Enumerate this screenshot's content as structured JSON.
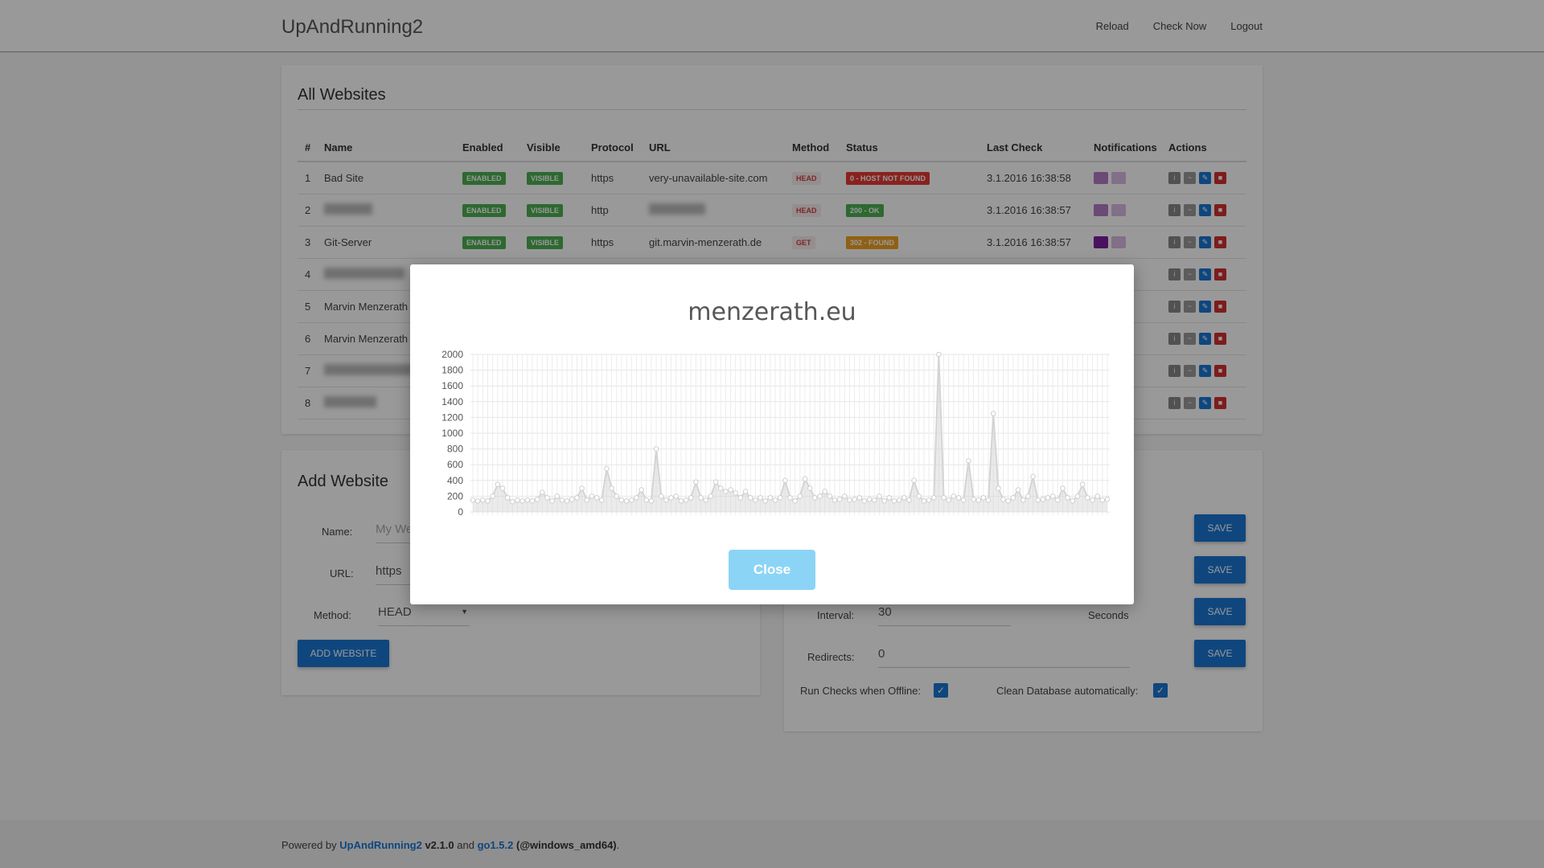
{
  "navbar": {
    "brand": "UpAndRunning2",
    "links": [
      "Reload",
      "Check Now",
      "Logout"
    ]
  },
  "all_websites": {
    "title": "All Websites",
    "columns": [
      "#",
      "Name",
      "Enabled",
      "Visible",
      "Protocol",
      "URL",
      "Method",
      "Status",
      "Last Check",
      "Notifications",
      "Actions"
    ],
    "rows": [
      {
        "num": "1",
        "name": "Bad Site",
        "enabled": "ENABLED",
        "visible": "VISIBLE",
        "protocol": "https",
        "url": "very-unavailable-site.com",
        "method": "HEAD",
        "status": "0 - HOST NOT FOUND",
        "last_check": "3.1.2016 16:38:58"
      },
      {
        "num": "2",
        "name": "",
        "enabled": "ENABLED",
        "visible": "VISIBLE",
        "protocol": "http",
        "url": "",
        "method": "HEAD",
        "status": "200 - OK",
        "last_check": "3.1.2016 16:38:57"
      },
      {
        "num": "3",
        "name": "Git-Server",
        "enabled": "ENABLED",
        "visible": "VISIBLE",
        "protocol": "https",
        "url": "git.marvin-menzerath.de",
        "method": "GET",
        "status": "302 - FOUND",
        "last_check": "3.1.2016 16:38:57"
      },
      {
        "num": "4",
        "name": ""
      },
      {
        "num": "5",
        "name": "Marvin Menzerath"
      },
      {
        "num": "6",
        "name": "Marvin Menzerath"
      },
      {
        "num": "7",
        "name": ""
      },
      {
        "num": "8",
        "name": ""
      }
    ]
  },
  "add_website": {
    "title": "Add Website",
    "name_label": "Name:",
    "name_placeholder": "My We",
    "url_label": "URL:",
    "url_value": "https",
    "method_label": "Method:",
    "method_value": "HEAD",
    "submit_label": "ADD WEBSITE"
  },
  "settings": {
    "interval_label": "Interval:",
    "interval_value": "30",
    "interval_unit": "Seconds",
    "redirects_label": "Redirects:",
    "redirects_value": "0",
    "save_label": "SAVE",
    "offline_label": "Run Checks when Offline:",
    "cleanup_label": "Clean Database automatically:"
  },
  "footer": {
    "prefix": "Powered by",
    "app_link": "UpAndRunning2",
    "app_version": "v2.1.0",
    "and": "and",
    "go_link": "go1.5.2",
    "platform": "(@windows_amd64)",
    "suffix": "."
  },
  "modal": {
    "title": "menzerath.eu",
    "close_label": "Close"
  },
  "chart_data": {
    "type": "line",
    "title": "menzerath.eu",
    "ylim": [
      0,
      2000
    ],
    "yticks": [
      0,
      200,
      400,
      600,
      800,
      1000,
      1200,
      1400,
      1600,
      1800,
      2000
    ],
    "grid": true,
    "series": [
      {
        "values": [
          150,
          140,
          150,
          140,
          200,
          350,
          300,
          180,
          130,
          150,
          140,
          150,
          140,
          160,
          250,
          180,
          140,
          200,
          150,
          140,
          160,
          180,
          300,
          150,
          200,
          180,
          150,
          550,
          300,
          200,
          150,
          140,
          150,
          180,
          280,
          150,
          140,
          800,
          200,
          150,
          180,
          200,
          140,
          150,
          180,
          380,
          180,
          150,
          200,
          380,
          300,
          260,
          280,
          240,
          180,
          260,
          180,
          150,
          180,
          140,
          180,
          150,
          180,
          400,
          180,
          140,
          200,
          420,
          300,
          180,
          200,
          260,
          200,
          150,
          160,
          200,
          150,
          160,
          180,
          140,
          160,
          150,
          200,
          140,
          180,
          140,
          150,
          180,
          150,
          400,
          200,
          140,
          150,
          180,
          2000,
          180,
          150,
          200,
          180,
          150,
          650,
          160,
          150,
          180,
          150,
          1250,
          300,
          160,
          140,
          180,
          280,
          150,
          200,
          450,
          150,
          160,
          180,
          200,
          150,
          300,
          180,
          140,
          200,
          350,
          180,
          150,
          200,
          150,
          160
        ]
      }
    ]
  }
}
